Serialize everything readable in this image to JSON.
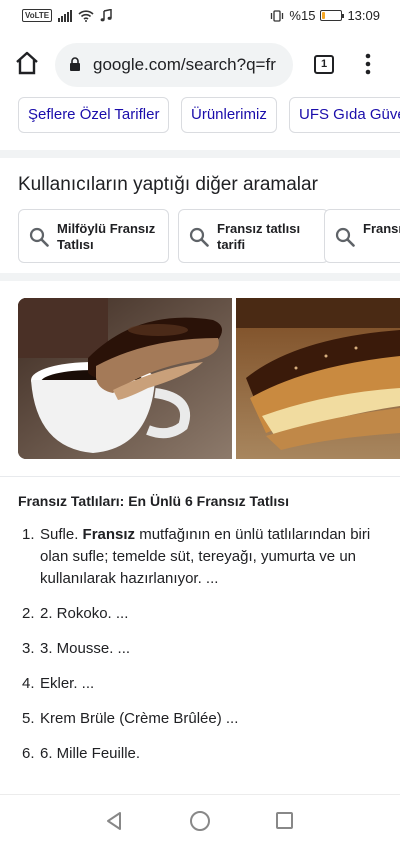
{
  "status_bar": {
    "volte": "VoLTE",
    "battery_text": "%15",
    "battery_level": 0.15,
    "time": "13:09"
  },
  "browser": {
    "url": "google.com/search?q=fr",
    "tab_count": "1"
  },
  "chips": [
    {
      "label": "Şeflere Özel Tarifler"
    },
    {
      "label": "Ürünlerimiz"
    },
    {
      "label": "UFS Gıda Güvenliği"
    }
  ],
  "related": {
    "title": "Kullanıcıların yaptığı diğer aramalar",
    "items": [
      {
        "label": "Milföylü Fransız Tatlısı"
      },
      {
        "label": "Fransız tatlısı tarifi"
      },
      {
        "label": "Fransız pastalar"
      }
    ]
  },
  "result": {
    "title": "Fransız Tatlıları: En Ünlü 6 Fransız Tatlısı",
    "steps": [
      {
        "num": "1.",
        "pre": "Sufle. ",
        "bold": "Fransız",
        "post": " mutfağının en ünlü tatlılarından biri olan sufle; temelde süt, tereyağı, yumurta ve un kullanılarak hazırlanıyor. ..."
      },
      {
        "num": "2.",
        "text": "2. Rokoko. ..."
      },
      {
        "num": "3.",
        "text": "3. Mousse. ..."
      },
      {
        "num": "4.",
        "text": "Ekler. ..."
      },
      {
        "num": "5.",
        "text": "Krem Brüle (Crème Brûlée) ..."
      },
      {
        "num": "6.",
        "text": "6. Mille Feuille."
      }
    ]
  },
  "colors": {
    "link": "#1a0dab",
    "text": "#202124",
    "border": "#dadce0"
  },
  "icons": [
    "home-icon",
    "lock-icon",
    "tabs-icon",
    "menu-icon",
    "search-icon",
    "back-icon",
    "circle-home-icon",
    "recent-apps-icon"
  ]
}
